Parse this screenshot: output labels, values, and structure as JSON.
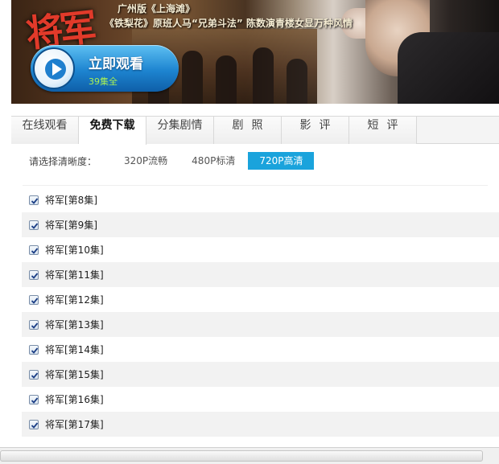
{
  "banner": {
    "logo_text": "将军",
    "line1": "广州版《上海滩》",
    "line2": "《铁梨花》原班人马“兄弟斗法” 陈数演青楼女显万种风情",
    "watch_label": "立即观看",
    "episode_count": "39集全"
  },
  "tabs": [
    {
      "label": "在线观看",
      "active": false
    },
    {
      "label": "免费下载",
      "active": true
    },
    {
      "label": "分集剧情",
      "active": false
    },
    {
      "label": "剧照",
      "active": false
    },
    {
      "label": "影评",
      "active": false
    },
    {
      "label": "短评",
      "active": false
    }
  ],
  "quality": {
    "label": "请选择清晰度：",
    "options": [
      "320P流畅",
      "480P标清",
      "720P高清"
    ],
    "selected": "720P高清"
  },
  "episodes": [
    {
      "title": "将军[第8集]",
      "checked": true
    },
    {
      "title": "将军[第9集]",
      "checked": true
    },
    {
      "title": "将军[第10集]",
      "checked": true
    },
    {
      "title": "将军[第11集]",
      "checked": true
    },
    {
      "title": "将军[第12集]",
      "checked": true
    },
    {
      "title": "将军[第13集]",
      "checked": true
    },
    {
      "title": "将军[第14集]",
      "checked": true
    },
    {
      "title": "将军[第15集]",
      "checked": true
    },
    {
      "title": "将军[第16集]",
      "checked": true
    },
    {
      "title": "将军[第17集]",
      "checked": true
    }
  ],
  "colors": {
    "accent": "#1aa3dc",
    "watch_button": "#1d84d0",
    "episode_count_text": "#a9f054",
    "row_alt": "#f2f2f2"
  },
  "icons": {
    "play": "play-icon",
    "checkbox": "checkmark-icon"
  }
}
